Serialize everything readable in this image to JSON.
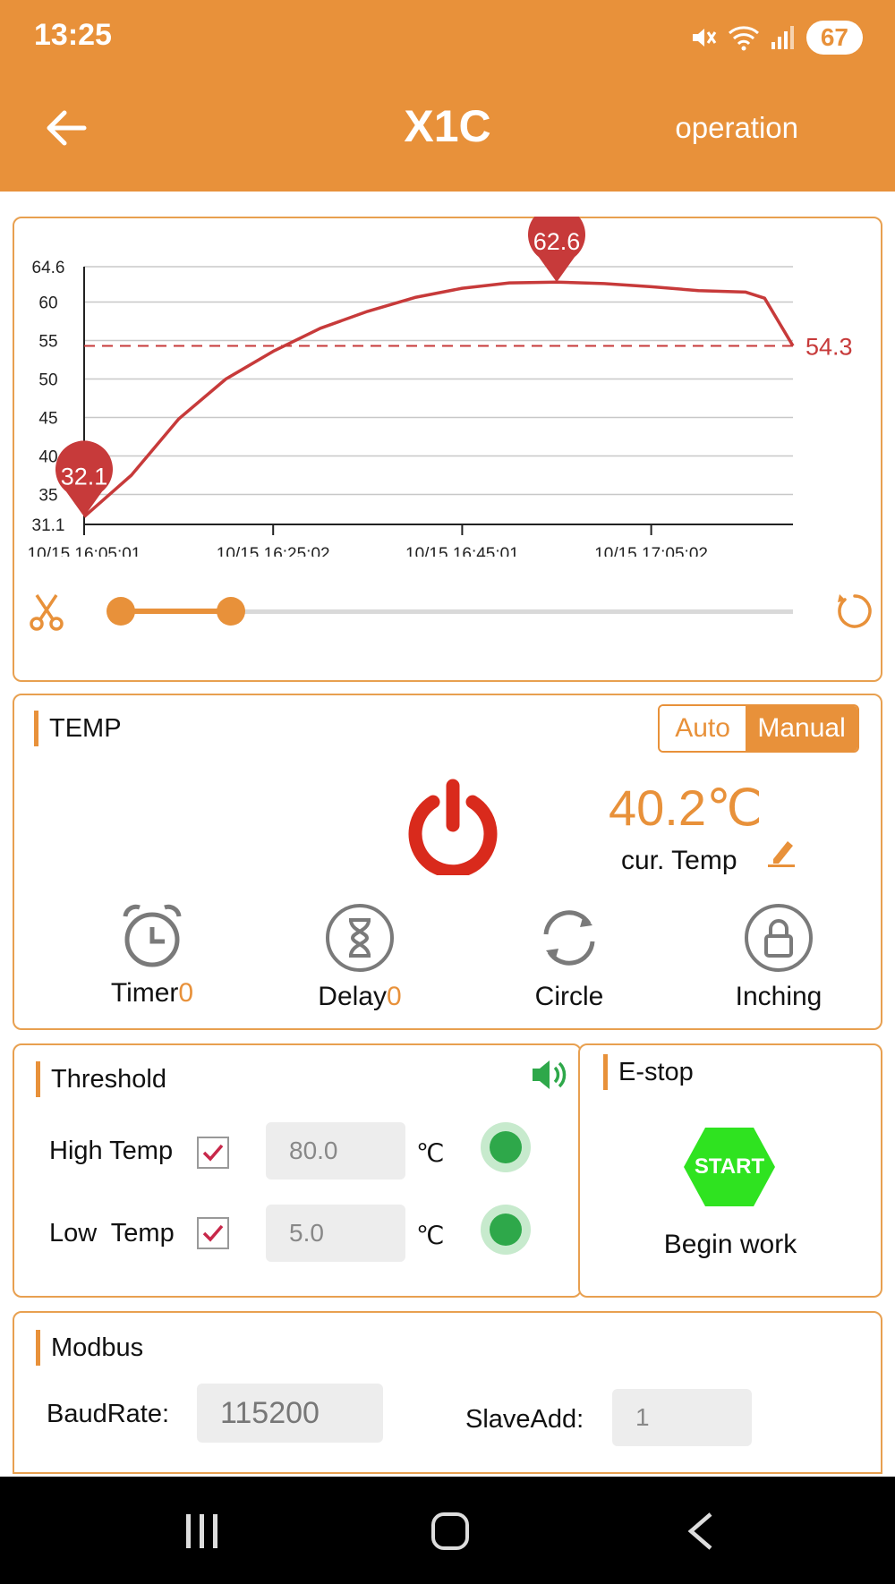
{
  "status_bar": {
    "time": "13:25",
    "battery": "67"
  },
  "header": {
    "title": "X1C",
    "action": "operation"
  },
  "chart_data": {
    "type": "line",
    "title": "",
    "xlabel": "",
    "ylabel": "",
    "ylim": [
      31.1,
      64.6
    ],
    "y_ticks": [
      "64.6",
      "60",
      "55",
      "50",
      "45",
      "40",
      "35",
      "31.1"
    ],
    "x_ticks": [
      "10/15 16:05:01",
      "10/15 16:25:02",
      "10/15 16:45:01",
      "10/15 17:05:02"
    ],
    "x_minutes": [
      0,
      5,
      10,
      15,
      20,
      25,
      30,
      35,
      40,
      45,
      50,
      55,
      60,
      65,
      70,
      72,
      75
    ],
    "values": [
      32.1,
      37.5,
      44.8,
      50.0,
      53.6,
      56.6,
      58.8,
      60.6,
      61.8,
      62.5,
      62.6,
      62.4,
      62.0,
      61.5,
      61.3,
      60.5,
      54.3
    ],
    "min_marker": "32.1",
    "max_marker": "62.6",
    "current_label": "54.3",
    "current_value": 54.3,
    "colors": {
      "line": "#C73A3A",
      "grid": "#C8C8C8"
    }
  },
  "range_slider": {
    "start_fraction": 0.02,
    "end_fraction": 0.18,
    "accent": "#E8913A"
  },
  "temp_panel": {
    "title": "TEMP",
    "mode_auto": "Auto",
    "mode_manual": "Manual",
    "current_value": "40.2℃",
    "current_label": "cur. Temp",
    "modes": [
      {
        "label": "Timer",
        "count": "0",
        "icon": "alarm-clock-icon"
      },
      {
        "label": "Delay",
        "count": "0",
        "icon": "hourglass-icon"
      },
      {
        "label": "Circle",
        "count": "",
        "icon": "cycle-icon"
      },
      {
        "label": "Inching",
        "count": "",
        "icon": "lock-icon"
      }
    ]
  },
  "threshold": {
    "title": "Threshold",
    "high_label": "High Temp",
    "high_value": "80.0",
    "low_label": "Low  Temp",
    "low_value": "5.0",
    "unit": "℃"
  },
  "estop": {
    "title": "E-stop",
    "button": "START",
    "caption": "Begin work"
  },
  "modbus": {
    "title": "Modbus",
    "baud_label": "BaudRate:",
    "baud_value": "115200",
    "slave_label": "SlaveAdd:",
    "slave_value": "1"
  }
}
